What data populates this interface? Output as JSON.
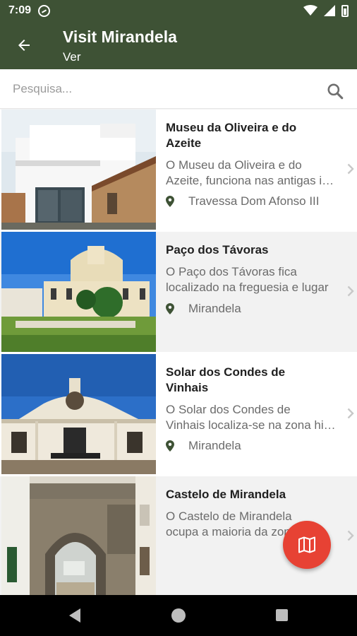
{
  "status_bar": {
    "time": "7:09",
    "icons": [
      "sync-icon",
      "wifi-icon",
      "signal-icon",
      "battery-icon"
    ]
  },
  "app_bar": {
    "title": "Visit Mirandela",
    "subtitle": "Ver",
    "back_icon": "arrow-left-icon"
  },
  "search": {
    "placeholder": "Pesquisa...",
    "value": "",
    "icon": "search-icon"
  },
  "items": [
    {
      "title_lines": [
        "Museu da Oliveira e do",
        "Azeite"
      ],
      "description_lines": [
        "O Museu da Oliveira e do",
        "Azeite, funciona nas antigas instalações"
      ],
      "location": "Travessa Dom Afonso III"
    },
    {
      "title_lines": [
        "Paço dos Távoras"
      ],
      "description_lines": [
        "O Paço dos Távoras fica",
        "localizado na freguesia e lugar"
      ],
      "location": "Mirandela"
    },
    {
      "title_lines": [
        "Solar dos Condes de",
        "Vinhais"
      ],
      "description_lines": [
        "O Solar dos Condes de",
        "Vinhais localiza-se na zona histórica"
      ],
      "location": "Mirandela"
    },
    {
      "title_lines": [
        "Castelo de Mirandela"
      ],
      "description_lines": [
        "O Castelo de Mirandela",
        "ocupa a maioria da zona"
      ],
      "location": ""
    }
  ],
  "fab": {
    "icon": "map-icon"
  },
  "colors": {
    "primary": "#3e5235",
    "accent": "#e74234",
    "list_alt_background": "#f2f2f2",
    "text_secondary": "#6b6b6b"
  }
}
